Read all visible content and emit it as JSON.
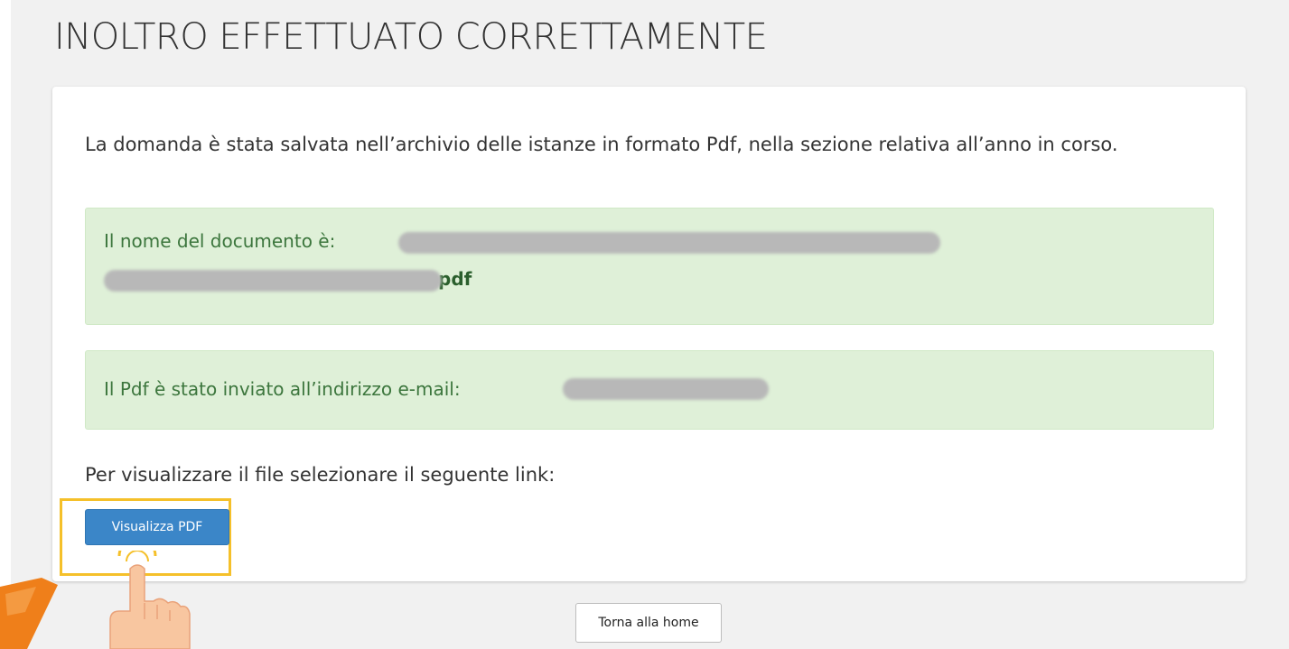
{
  "page": {
    "title": "INOLTRO EFFETTUATO CORRETTAMENTE"
  },
  "panel": {
    "intro_text": "La domanda è stata salvata nell’archivio delle istanze in formato Pdf, nella sezione relativa all’anno in corso.",
    "document_alert": {
      "label": "Il nome del documento è:",
      "filename_suffix": "pdf"
    },
    "email_alert": {
      "label": "Il Pdf è stato inviato all’indirizzo e-mail:"
    },
    "link_prompt": "Per visualizzare il file selezionare il seguente link:",
    "view_pdf_button": "Visualizza PDF"
  },
  "footer": {
    "home_button": "Torna alla home"
  },
  "overlay": {
    "highlight_color": "#f5c02a",
    "pointer": "pointing-hand-icon"
  },
  "colors": {
    "alert_bg": "#dff0d8",
    "alert_text": "#3c763d",
    "primary_button": "#3b86c8"
  }
}
